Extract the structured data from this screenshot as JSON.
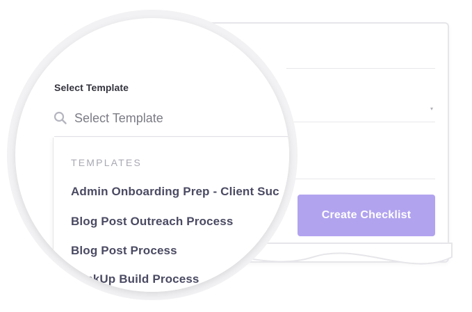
{
  "form": {
    "field_label": "Select Template",
    "search_placeholder": "Select Template",
    "create_button_label": "Create Checklist"
  },
  "dropdown": {
    "section_header": "TEMPLATES",
    "items": [
      {
        "label": "Admin Onboarding Prep - Client Suc"
      },
      {
        "label": "Blog Post Outreach Process"
      },
      {
        "label": "Blog Post Process"
      },
      {
        "label": "ClickUp Build Process"
      }
    ]
  },
  "colors": {
    "accent": "#b2a3ef",
    "text_primary": "#4a4a63",
    "muted": "#a8a8b3"
  },
  "icons": {
    "search": "search-icon",
    "select_caret": "caret-down-icon"
  }
}
